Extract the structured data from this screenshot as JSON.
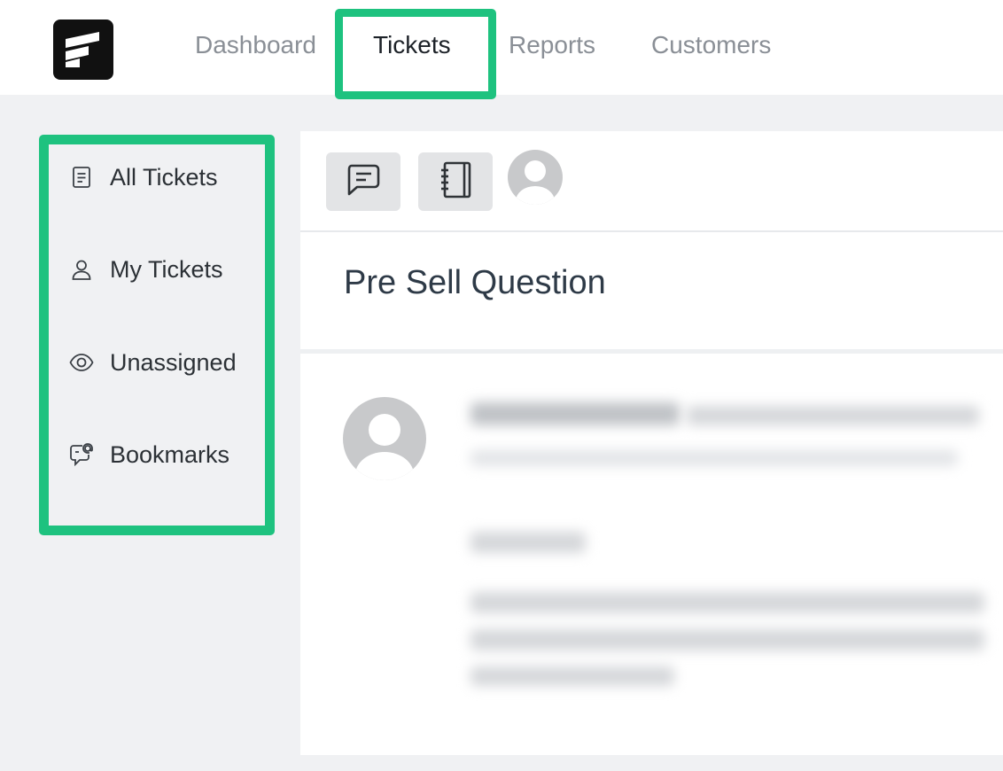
{
  "nav": {
    "items": [
      {
        "label": "Dashboard"
      },
      {
        "label": "Tickets"
      },
      {
        "label": "Reports"
      },
      {
        "label": "Customers"
      }
    ],
    "active": "Tickets"
  },
  "sidebar": {
    "items": [
      {
        "label": "All Tickets",
        "icon": "document-list-icon"
      },
      {
        "label": "My Tickets",
        "icon": "user-icon"
      },
      {
        "label": "Unassigned",
        "icon": "eye-icon"
      },
      {
        "label": "Bookmarks",
        "icon": "chat-at-icon"
      }
    ]
  },
  "toolbar": {
    "buttons": [
      {
        "icon": "chat-icon"
      },
      {
        "icon": "notebook-icon"
      }
    ],
    "avatar_icon": "user-avatar-icon"
  },
  "ticket": {
    "title": "Pre Sell Question"
  },
  "colors": {
    "highlight": "#1ec27f",
    "nav_active": "#1d2228",
    "nav_inactive": "#8a8f96",
    "page_bg": "#f0f1f3"
  }
}
